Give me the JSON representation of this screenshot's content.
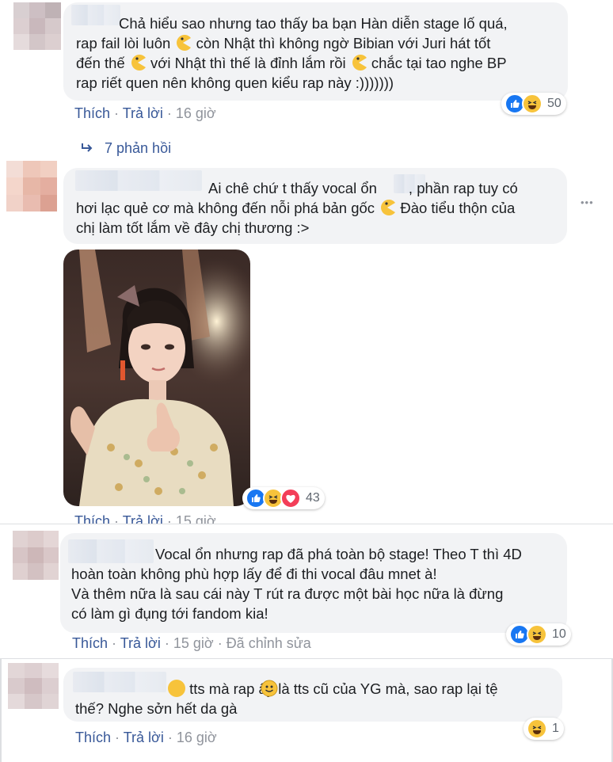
{
  "comments": [
    {
      "text_parts": [
        "Chả hiểu sao nhưng tao thấy ba bạn Hàn diễn stage lố quá,\nrap fail lòi luôn ",
        " còn Nhật thì không ngờ Bibian với Juri hát tốt\nđến thế ",
        " với Nhật thì thế là đỉnh lắm rồi ",
        " chắc tại tao nghe BP\nrap riết quen nên không quen kiểu rap này :)))))))"
      ],
      "actions": {
        "like": "Thích",
        "reply": "Trả lời",
        "time": "16 giờ"
      },
      "reactions": {
        "count": "50",
        "types": [
          "like-icon",
          "haha-icon"
        ]
      }
    },
    {
      "text_parts": [
        "Ai chê chứ t thấy vocal ổn",
        ", phần rap tuy có\nhơi lạc quẻ cơ mà không đến nỗi phá bản gốc ",
        " Đào tiểu thộn của\nchị làm tốt lắm về đây chị thương :>"
      ],
      "actions": {
        "like": "Thích",
        "reply": "Trả lời",
        "time": "15 giờ"
      },
      "reactions": {
        "count": "43",
        "types": [
          "like-icon",
          "haha-icon",
          "love-icon"
        ]
      }
    },
    {
      "text": "Vocal ổn nhưng rap đã phá toàn bộ stage! Theo T thì 4D\nhoàn toàn không phù hợp lấy để đi thi vocal đâu mnet à!\nVà thêm nữa là sau cái này T rút ra được một bài học nữa là đừng\ncó làm gì đụng tới fandom kia!",
      "actions": {
        "like": "Thích",
        "reply": "Trả lời",
        "time": "15 giờ",
        "edited": "Đã chỉnh sửa"
      },
      "reactions": {
        "count": "10",
        "types": [
          "like-icon",
          "haha-icon"
        ]
      }
    },
    {
      "text": " tts mà rap ấy là tts cũ của YG mà, sao rap lại tệ\nthế? Nghe sởn hết da gà",
      "actions": {
        "like": "Thích",
        "reply": "Trả lời",
        "time": "16 giờ"
      },
      "reactions": {
        "count": "1",
        "types": [
          "haha-icon"
        ]
      }
    }
  ],
  "replies_link": "7 phản hồi",
  "separator": " · ",
  "more_menu": "•••",
  "colors": {
    "link": "#385898",
    "meta": "#90949c",
    "bubble": "#f2f3f5",
    "like": "#1877f2",
    "haha": "#f7c33b",
    "love": "#f33e58"
  }
}
